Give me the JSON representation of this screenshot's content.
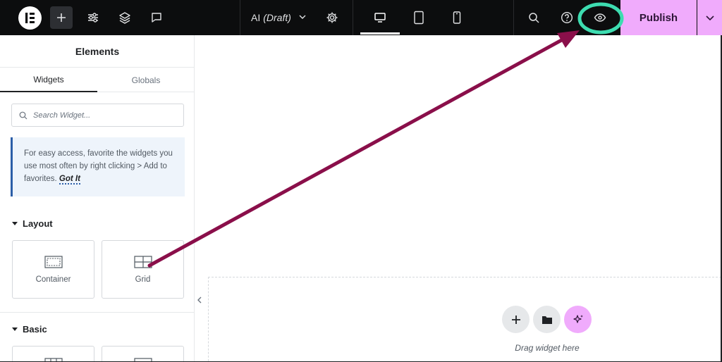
{
  "topbar": {
    "logo_icon": "elementor-logo-icon",
    "add_icon": "plus-icon",
    "settings_icon": "sliders-icon",
    "structure_icon": "layers-icon",
    "notes_icon": "comment-icon",
    "doc_title": "AI",
    "doc_status": "(Draft)",
    "doc_chevron_icon": "chevron-down-icon",
    "page_settings_icon": "gear-icon",
    "devices": [
      "desktop-icon",
      "tablet-icon",
      "mobile-icon"
    ],
    "active_device": "desktop",
    "search_icon": "search-icon",
    "help_icon": "help-circle-icon",
    "preview_icon": "eye-icon",
    "publish_label": "Publish",
    "publish_more_icon": "chevron-down-icon"
  },
  "panel": {
    "title": "Elements",
    "tabs": [
      {
        "label": "Widgets",
        "active": true
      },
      {
        "label": "Globals",
        "active": false
      }
    ],
    "search": {
      "placeholder": "Search Widget..."
    },
    "tip": {
      "text": "For easy access, favorite the widgets you use most often by right clicking > Add to favorites.",
      "link": "Got It"
    },
    "sections": [
      {
        "title": "Layout",
        "widgets": [
          {
            "label": "Container",
            "icon": "container-icon"
          },
          {
            "label": "Grid",
            "icon": "grid-icon"
          }
        ]
      },
      {
        "title": "Basic",
        "widgets": [
          {
            "label": "",
            "icon": "inner-section-icon"
          },
          {
            "label": "",
            "icon": "heading-icon"
          }
        ]
      }
    ]
  },
  "canvas": {
    "drop_buttons": [
      "plus-icon",
      "folder-icon",
      "sparkle-icon"
    ],
    "drag_text": "Drag widget here"
  },
  "annotation": {
    "highlight_color": "#3ddcb0",
    "arrow_color": "#8a0f4a"
  },
  "colors": {
    "topbar_bg": "#0c0d0e",
    "publish_bg": "#f0abfc",
    "tip_bg": "#eef4fb",
    "tip_accent": "#2c5ea8"
  }
}
